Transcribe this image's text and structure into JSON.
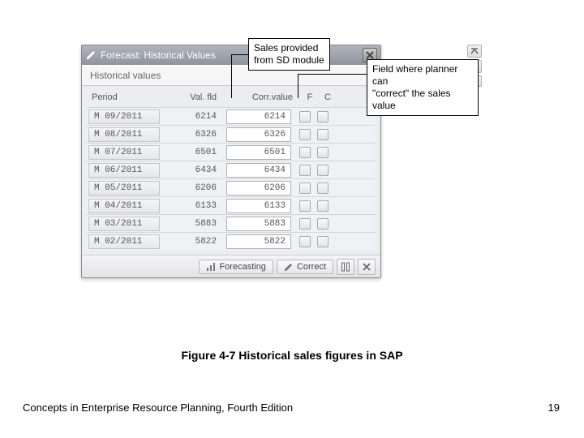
{
  "window": {
    "title": "Forecast: Historical Values",
    "subheader": "Historical values",
    "columns": {
      "period": "Period",
      "val": "Val. fld",
      "corr": "Corr.value",
      "f": "F",
      "c": "C"
    },
    "rows": [
      {
        "period": "M 09/2011",
        "val": "6214",
        "corr": "6214"
      },
      {
        "period": "M 08/2011",
        "val": "6326",
        "corr": "6326"
      },
      {
        "period": "M 07/2011",
        "val": "6501",
        "corr": "6501"
      },
      {
        "period": "M 06/2011",
        "val": "6434",
        "corr": "6434"
      },
      {
        "period": "M 05/2011",
        "val": "6206",
        "corr": "6206"
      },
      {
        "period": "M 04/2011",
        "val": "6133",
        "corr": "6133"
      },
      {
        "period": "M 03/2011",
        "val": "5883",
        "corr": "5883"
      },
      {
        "period": "M 02/2011",
        "val": "5822",
        "corr": "5822"
      }
    ],
    "buttons": {
      "forecasting": "Forecasting",
      "correct": "Correct"
    }
  },
  "annotations": {
    "sales_provided": "Sales provided\nfrom SD module",
    "field_correct": "Field where planner can\n\"correct\" the sales value"
  },
  "caption": "Figure 4-7  Historical sales figures in SAP",
  "footer": "Concepts in Enterprise Resource Planning, Fourth Edition",
  "page": "19"
}
